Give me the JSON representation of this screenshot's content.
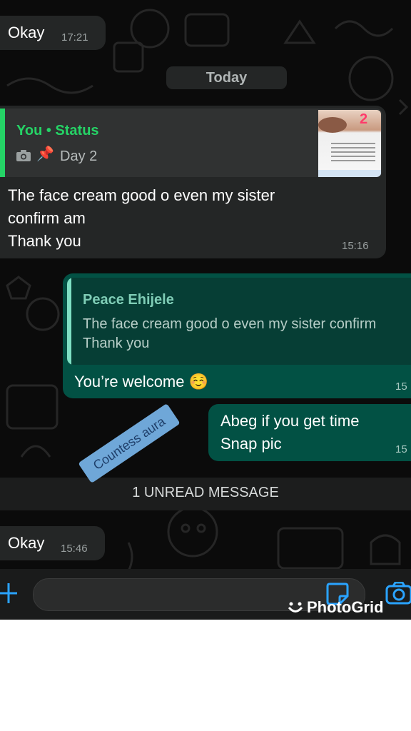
{
  "messages": {
    "first": {
      "text": "Okay",
      "time": "17:21"
    },
    "date_divider": "Today",
    "status_reply": {
      "quote_author": "You • Status",
      "quote_icons": "📷 📌",
      "quote_text": "Day 2",
      "thumb_badge": "2",
      "text_line1": "The face cream good o even my sister",
      "text_line2": "confirm am",
      "text_line3": "Thank you",
      "time": "15:16"
    },
    "welcome_reply": {
      "quote_author": "Peace Ehijele",
      "quote_line1": "The face cream good o even my sister confirm",
      "quote_line2": "Thank you",
      "text": "You’re welcome ☺️",
      "time": "15"
    },
    "abeg": {
      "line1": "Abeg if you get time",
      "line2": "Snap pic",
      "time": "15"
    },
    "unread_divider": "1 UNREAD MESSAGE",
    "last": {
      "text": "Okay",
      "time": "15:46"
    }
  },
  "sticker": {
    "text": "Countess aura"
  },
  "input_bar": {
    "attach_icon": "plus-icon",
    "sticker_icon": "sticker-icon",
    "camera_icon": "camera-icon"
  },
  "watermark": {
    "text": "PhotoGrid"
  },
  "colors": {
    "accent": "#25d366",
    "outgoing": "#025144",
    "incoming": "#242626",
    "sticker": "#6fa7d8"
  }
}
